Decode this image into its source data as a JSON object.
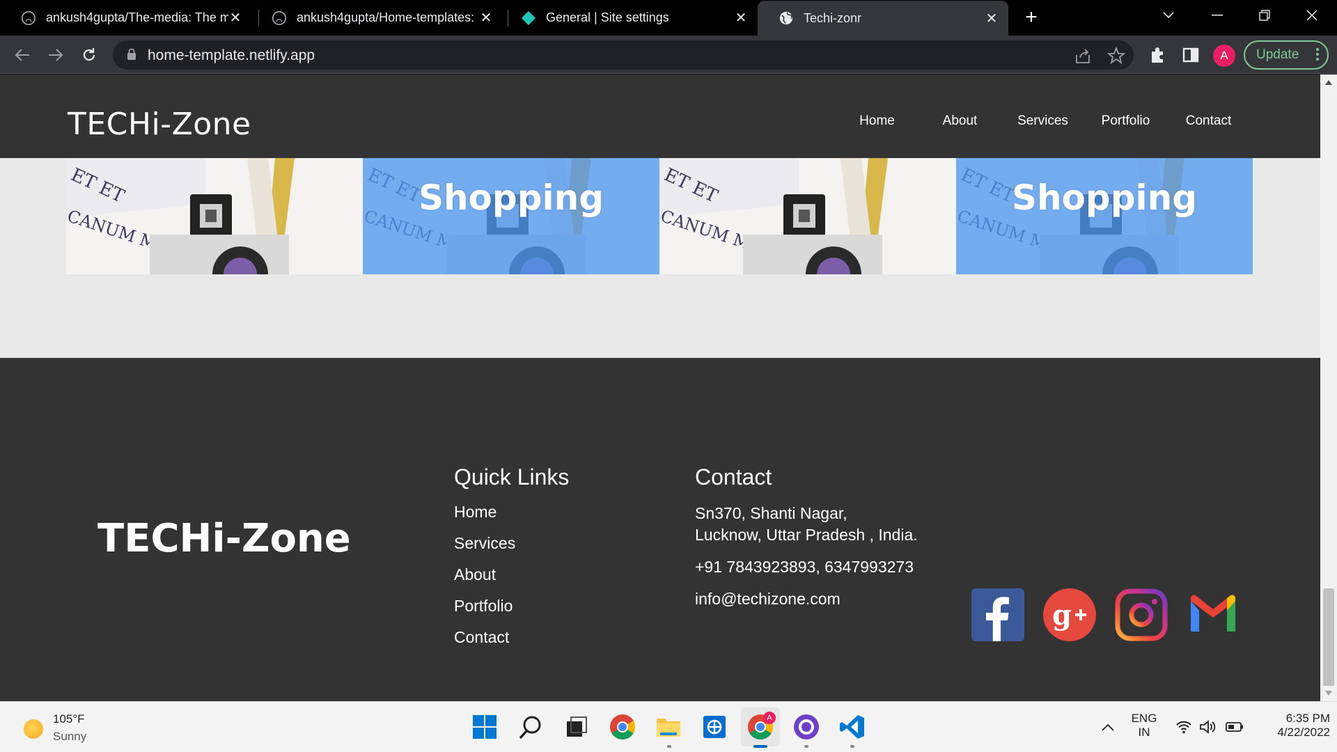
{
  "browser": {
    "tabs": [
      {
        "title": "ankush4gupta/The-media: The m",
        "favicon": "github-icon",
        "active": false
      },
      {
        "title": "ankush4gupta/Home-templates:",
        "favicon": "github-icon",
        "active": false
      },
      {
        "title": "General | Site settings",
        "favicon": "netlify-icon",
        "active": false
      },
      {
        "title": "Techi-zonr",
        "favicon": "globe-icon",
        "active": true
      }
    ],
    "url": "home-template.netlify.app",
    "profile_initial": "A",
    "update_label": "Update"
  },
  "site": {
    "logo": "TECHi-Zone",
    "nav": [
      "Home",
      "About",
      "Services",
      "Portfolio",
      "Contact"
    ],
    "gallery": [
      {
        "overlay": false,
        "title": ""
      },
      {
        "overlay": true,
        "title": "Shopping"
      },
      {
        "overlay": false,
        "title": ""
      },
      {
        "overlay": true,
        "title": "Shopping"
      }
    ],
    "footer": {
      "brand": "TECHi-Zone",
      "quick_links_title": "Quick Links",
      "quick_links": [
        "Home",
        "Services",
        "About",
        "Portfolio",
        "Contact"
      ],
      "contact_title": "Contact",
      "address_line1": "Sn370, Shanti Nagar,",
      "address_line2": "Lucknow, Uttar Pradesh , India.",
      "phone": "+91 7843923893, 6347993273",
      "email": "info@techizone.com",
      "social": [
        "facebook-icon",
        "google-plus-icon",
        "instagram-icon",
        "gmail-icon"
      ]
    }
  },
  "taskbar": {
    "temperature": "105°F",
    "weather": "Sunny",
    "lang_line1": "ENG",
    "lang_line2": "IN",
    "time": "6:35 PM",
    "date": "4/22/2022",
    "notification_badge": "A"
  },
  "colors": {
    "site_dark": "#333333",
    "page_bg": "#e9e9e9",
    "overlay_blue": "#6aa8ef",
    "update_green": "#81c995"
  }
}
